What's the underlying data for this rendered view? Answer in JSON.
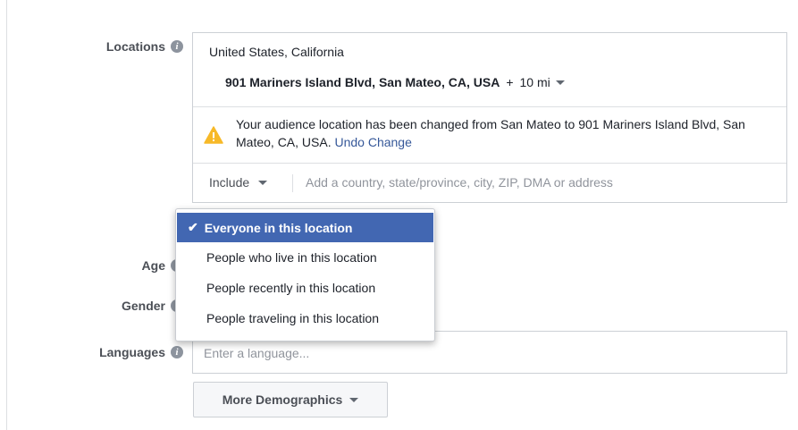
{
  "labels": {
    "locations": "Locations",
    "age": "Age",
    "gender": "Gender",
    "languages": "Languages"
  },
  "locations": {
    "country": "United States, California",
    "address": "901 Mariners Island Blvd, San Mateo, CA, USA",
    "plus": "+",
    "radius": "10 mi",
    "warning_text": "Your audience location has been changed from San Mateo to 901 Mariners Island Blvd, San Mateo, CA, USA.",
    "undo_label": "Undo Change",
    "include_label": "Include",
    "search_placeholder": "Add a country, state/province, city, ZIP, DMA or address"
  },
  "dropdown": {
    "items": [
      {
        "label": "Everyone in this location",
        "selected": true
      },
      {
        "label": "People who live in this location",
        "selected": false
      },
      {
        "label": "People recently in this location",
        "selected": false
      },
      {
        "label": "People traveling in this location",
        "selected": false
      }
    ]
  },
  "languages": {
    "placeholder": "Enter a language..."
  },
  "more_demographics": {
    "label": "More Demographics"
  },
  "colors": {
    "accent": "#4267b2",
    "link": "#365899",
    "warning": "#f7b928"
  }
}
